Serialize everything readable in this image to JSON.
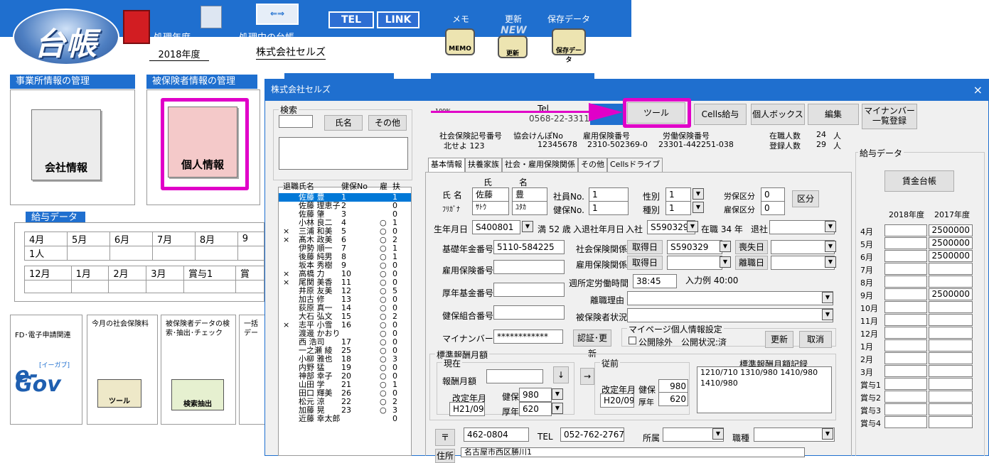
{
  "app": {
    "logo_text": "台帳",
    "year_label": "処理年度",
    "year_value": "2018年度",
    "ledger_label": "処理中の台帳",
    "ledger_value": "株式会社セルズ",
    "tel": "TEL",
    "link": "LINK",
    "memo_label": "メモ",
    "memo_icon": "MEMO",
    "update_label": "更新",
    "update_badge": "NEW",
    "update_icon": "更新",
    "save_label": "保存データ",
    "save_icon": "保存データ"
  },
  "sections": {
    "office": "事業所情報の管理",
    "insured": "被保険者情報の管理",
    "salary_data": "給与データ",
    "company_info": "会社情報",
    "personal_info": "個人情報"
  },
  "kyu_months_row1": [
    "4月",
    "5月",
    "6月",
    "7月",
    "8月",
    "9"
  ],
  "kyu_count": "1人",
  "kyu_months_row2": [
    "12月",
    "1月",
    "2月",
    "3月",
    "賞与1",
    "賞"
  ],
  "cards": {
    "fd": "FD･電子申請関連",
    "egov_small": "[イーガブ]",
    "egov": "e-Gov",
    "today": "今月の社会保険料",
    "today_btn": "ツール",
    "search": "被保険者データの検索･抽出･チェック",
    "search_btn": "検索抽出",
    "partial": "一括デー"
  },
  "dialog": {
    "title": "株式会社セルズ",
    "close": "×",
    "search_group": "検索",
    "name_btn": "氏名",
    "other_btn": "その他",
    "zoom": "100%",
    "tel_label": "Tel",
    "tel_value": "0568-22-3311",
    "tool_btn": "ツール",
    "cells_btn": "Cells給与",
    "personal_box_btn": "個人ボックス",
    "edit_btn": "編集",
    "mynumber_btn": "マイナンバー一覧登録",
    "hdr_labels": [
      "社会保険記号番号",
      "協会けんぽNo",
      "雇用保険番号",
      "労働保険番号",
      "在職人数",
      "登録人数"
    ],
    "hdr_values": [
      "北せよ 123",
      "12345678",
      "2310-502369-0",
      "23301-442251-038"
    ],
    "in_office": "24",
    "registered": "29",
    "unit": "人",
    "list_headers": [
      "退職",
      "氏名",
      "健保No",
      "雇",
      "扶"
    ],
    "employees": [
      {
        "r": "",
        "n": "佐藤 豊",
        "no": "1",
        "k": "",
        "f": "1",
        "sel": true
      },
      {
        "r": "",
        "n": "佐藤 理恵子",
        "no": "2",
        "k": "",
        "f": "0"
      },
      {
        "r": "",
        "n": "佐藤 肇",
        "no": "3",
        "k": "",
        "f": "0"
      },
      {
        "r": "",
        "n": "小林 良二",
        "no": "4",
        "k": "○",
        "f": "1"
      },
      {
        "r": "×",
        "n": "三浦 和美",
        "no": "5",
        "k": "○",
        "f": "0"
      },
      {
        "r": "×",
        "n": "髙木 政美",
        "no": "6",
        "k": "○",
        "f": "2"
      },
      {
        "r": "",
        "n": "伊勢 順一",
        "no": "7",
        "k": "○",
        "f": "1"
      },
      {
        "r": "",
        "n": "後藤 純男",
        "no": "8",
        "k": "○",
        "f": "1"
      },
      {
        "r": "",
        "n": "坂本 秀樹",
        "no": "9",
        "k": "○",
        "f": "0"
      },
      {
        "r": "×",
        "n": "高橋 力",
        "no": "10",
        "k": "○",
        "f": "0"
      },
      {
        "r": "×",
        "n": "尾関 美香",
        "no": "11",
        "k": "○",
        "f": "0"
      },
      {
        "r": "",
        "n": "井原 友美",
        "no": "12",
        "k": "○",
        "f": "5"
      },
      {
        "r": "",
        "n": "加古 修",
        "no": "13",
        "k": "○",
        "f": "0"
      },
      {
        "r": "",
        "n": "荻原 真一",
        "no": "14",
        "k": "○",
        "f": "0"
      },
      {
        "r": "",
        "n": "大石 弘文",
        "no": "15",
        "k": "○",
        "f": "2"
      },
      {
        "r": "×",
        "n": "志平 小雪",
        "no": "16",
        "k": "○",
        "f": "0"
      },
      {
        "r": "",
        "n": "渡邊 かおり",
        "no": "",
        "k": "○",
        "f": "0"
      },
      {
        "r": "",
        "n": "西 浩司",
        "no": "17",
        "k": "○",
        "f": "0"
      },
      {
        "r": "",
        "n": "一之瀬 綾",
        "no": "25",
        "k": "○",
        "f": "0"
      },
      {
        "r": "",
        "n": "小柳 雅也",
        "no": "18",
        "k": "○",
        "f": "3"
      },
      {
        "r": "",
        "n": "内野 猛",
        "no": "19",
        "k": "○",
        "f": "0"
      },
      {
        "r": "",
        "n": "神部 幸子",
        "no": "20",
        "k": "○",
        "f": "0"
      },
      {
        "r": "",
        "n": "山田 学",
        "no": "21",
        "k": "○",
        "f": "1"
      },
      {
        "r": "",
        "n": "田口 輝美",
        "no": "26",
        "k": "○",
        "f": "0"
      },
      {
        "r": "",
        "n": "松元 涼",
        "no": "22",
        "k": "○",
        "f": "2"
      },
      {
        "r": "",
        "n": "加藤 晃",
        "no": "23",
        "k": "○",
        "f": "3"
      },
      {
        "r": "",
        "n": "近藤 幸太郎",
        "no": "",
        "k": "",
        "f": "0"
      }
    ],
    "tabs": [
      "基本情報",
      "扶養家族",
      "社会・雇用保険関係",
      "その他",
      "Cellsドライブ"
    ],
    "form": {
      "sei": "氏",
      "mei": "名",
      "name_label": "氏 名",
      "sei_val": "佐藤",
      "mei_val": "豊",
      "kana_label": "ﾌﾘｶﾞﾅ",
      "kana_sei": "ｻﾄｳ",
      "kana_mei": "ﾕﾀｶ",
      "emp_no_label": "社員No.",
      "emp_no": "1",
      "kenpo_label": "健保No.",
      "kenpo": "1",
      "sex_label": "性別",
      "sex": "1",
      "kind_label": "種別",
      "kind": "1",
      "rosai_label": "労保区分",
      "rosai": "0",
      "koyo_label": "雇保区分",
      "koyo": "0",
      "kubun_btn": "区分",
      "birth_label": "生年月日",
      "birth": "S400801",
      "age": "満 52 歳",
      "inout_label": "入退社年月日",
      "in_label": "入社",
      "in_val": "S590329",
      "tenure": "在職 34 年",
      "out_label": "退社",
      "pension_label": "基礎年金番号",
      "pension": "5110-584225",
      "shaho_label": "社会保険関係",
      "get_btn": "取得日",
      "shaho_val": "S590329",
      "loss_btn": "喪失日",
      "koyo_no_label": "雇用保険番号",
      "koyo_rel_label": "雇用保険関係",
      "koyo_get_btn": "取得日",
      "leave_btn": "離職日",
      "hours_label": "週所定労働時間",
      "hours": "38:45",
      "hours_ex": "入力例 40:00",
      "kosei_label": "厚年基金番号",
      "reason_label": "離職理由",
      "kumiai_label": "健保組合番号",
      "status_label": "被保険者状況",
      "mynum_label": "マイナンバー",
      "mynum": "************",
      "auth_btn": "認証･更新",
      "myp_group": "マイページ個人情報設定",
      "myp_exclude": "公開除外",
      "myp_status": "公開状況:済",
      "myp_update": "更新",
      "myp_cancel": "取消",
      "std_group": "標準報酬月額",
      "now_group": "現在",
      "fee_label": "報酬月額",
      "down_btn": "↓",
      "right_btn": "→",
      "rev_label": "改定年月",
      "rev_val": "H21/09",
      "kenpo2": "健保",
      "kenpo_amt": "980",
      "kosei2": "厚年",
      "kosei_amt": "620",
      "prev_group": "従前",
      "prev_rev_label": "改定年月",
      "prev_rev": "H20/09",
      "prev_kenpo": "980",
      "prev_kosei": "620",
      "record_label": "標準報酬月額記録",
      "record": "1210/710 1310/980 1410/980 1410/980",
      "zip_btn": "〒",
      "zip": "462-0804",
      "tel_label": "TEL",
      "tel": "052-762-2767",
      "dept_label": "所属",
      "job_label": "職種",
      "addr_label": "住所",
      "addr": "名古屋市西区勝川1"
    },
    "salary": {
      "group": "給与データ",
      "wage_btn": "賃金台帳",
      "years": [
        "2018年度",
        "2017年度"
      ],
      "months": [
        "4月",
        "5月",
        "6月",
        "7月",
        "8月",
        "9月",
        "10月",
        "11月",
        "12月",
        "1月",
        "2月",
        "3月",
        "賞与1",
        "賞与2",
        "賞与3",
        "賞与4"
      ],
      "v2017": [
        "2500000",
        "2500000",
        "2500000",
        "",
        "",
        "2500000",
        "",
        "",
        "",
        "",
        "",
        "",
        "",
        "",
        "",
        ""
      ]
    }
  }
}
